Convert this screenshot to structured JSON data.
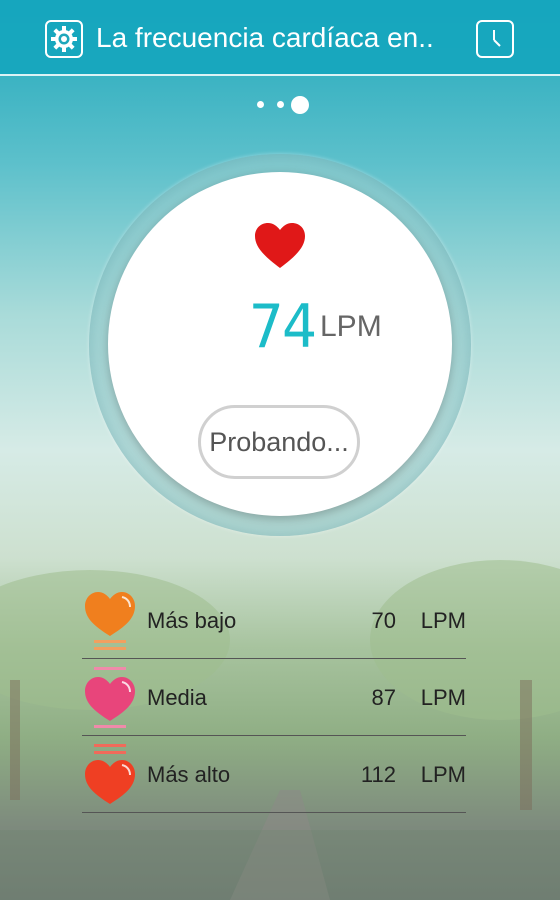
{
  "app": {
    "title": "La frecuencia cardíaca en..",
    "settings_icon": "gear-icon",
    "history_icon": "clock-icon"
  },
  "pager": {
    "pages": 3,
    "active_index": 2
  },
  "measurement": {
    "value": "74",
    "unit": "LPM",
    "heart_icon": "heart-icon",
    "status_button": "Probando..."
  },
  "stats": [
    {
      "label": "Más bajo",
      "value": "70",
      "unit": "LPM",
      "icon": "heart-low-icon",
      "color": "#f07f1e"
    },
    {
      "label": "Media",
      "value": "87",
      "unit": "LPM",
      "icon": "heart-avg-icon",
      "color": "#e8457b"
    },
    {
      "label": "Más alto",
      "value": "112",
      "unit": "LPM",
      "icon": "heart-high-icon",
      "color": "#ef3f23"
    }
  ],
  "colors": {
    "accent": "#1ea7bb",
    "bpm": "#1cbcc8",
    "heart": "#e01818"
  }
}
